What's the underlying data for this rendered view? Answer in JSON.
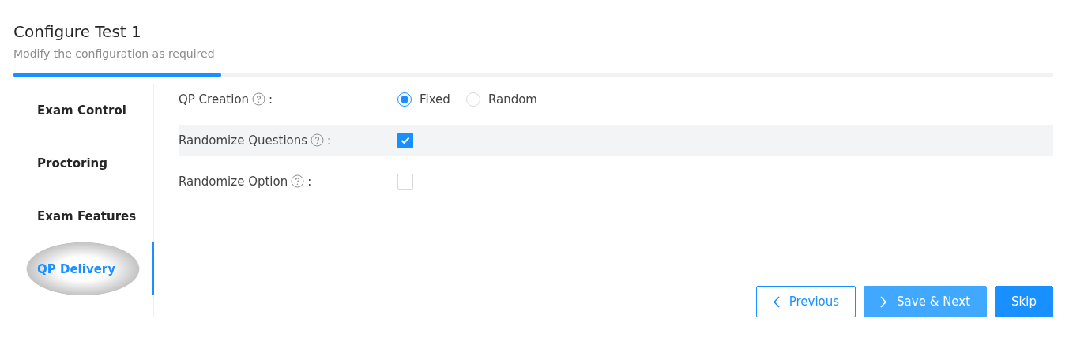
{
  "header": {
    "title": "Configure Test 1",
    "subtitle": "Modify the configuration as required"
  },
  "progress": {
    "level": 0.2
  },
  "sidebar": {
    "items": [
      {
        "label": "Exam Control",
        "selected": false
      },
      {
        "label": "Proctoring",
        "selected": false
      },
      {
        "label": "Exam Features",
        "selected": false
      },
      {
        "label": "QP Delivery",
        "selected": true
      }
    ]
  },
  "settings": [
    {
      "kind": "radio",
      "label": "QP Creation",
      "suffix": ":",
      "highlighted": false,
      "options": [
        {
          "label": "Fixed",
          "selected": true
        },
        {
          "label": "Random",
          "selected": false
        }
      ]
    },
    {
      "kind": "checkbox",
      "label": "Randomize Questions",
      "suffix": ":",
      "highlighted": true,
      "checked": true
    },
    {
      "kind": "checkbox",
      "label": "Randomize Option",
      "suffix": ":",
      "highlighted": false,
      "checked": false
    }
  ],
  "buttons": [
    {
      "kind": "outline",
      "label": "Previous"
    },
    {
      "kind": "light",
      "label": "Save & Next"
    },
    {
      "kind": "primary",
      "label": "Skip"
    }
  ]
}
